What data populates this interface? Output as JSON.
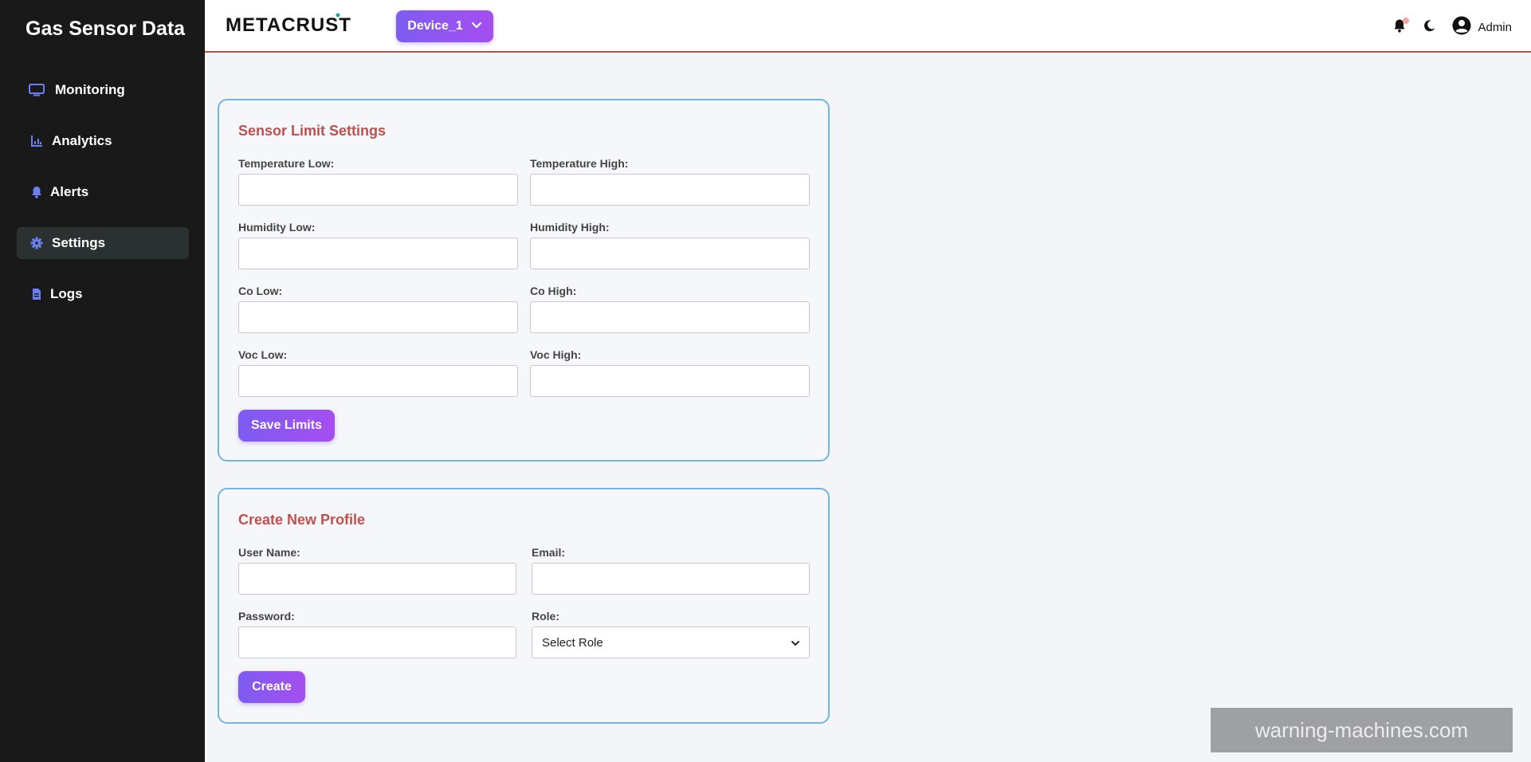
{
  "sidebar": {
    "brand": "Gas Sensor Data",
    "items": [
      {
        "label": "Monitoring",
        "icon": "monitor-icon",
        "active": false
      },
      {
        "label": "Analytics",
        "icon": "chart-icon",
        "active": false
      },
      {
        "label": "Alerts",
        "icon": "bell-icon",
        "active": false
      },
      {
        "label": "Settings",
        "icon": "gear-icon",
        "active": true
      },
      {
        "label": "Logs",
        "icon": "file-icon",
        "active": false
      }
    ]
  },
  "header": {
    "logo": "METACRUST",
    "device_selector": "Device_1",
    "user": "Admin",
    "icons": [
      "bell-icon",
      "moon-icon",
      "user-circle-icon"
    ]
  },
  "sensor_limits": {
    "title": "Sensor Limit Settings",
    "fields": [
      {
        "label": "Temperature Low:",
        "value": ""
      },
      {
        "label": "Temperature High:",
        "value": ""
      },
      {
        "label": "Humidity Low:",
        "value": ""
      },
      {
        "label": "Humidity High:",
        "value": ""
      },
      {
        "label": "Co Low:",
        "value": ""
      },
      {
        "label": "Co High:",
        "value": ""
      },
      {
        "label": "Voc Low:",
        "value": ""
      },
      {
        "label": "Voc High:",
        "value": ""
      }
    ],
    "save_label": "Save Limits"
  },
  "create_profile": {
    "title": "Create New Profile",
    "username_label": "User Name:",
    "email_label": "Email:",
    "password_label": "Password:",
    "role_label": "Role:",
    "role_value": "Select Role",
    "create_label": "Create"
  },
  "watermark": "warning-machines.com",
  "colors": {
    "sidebar_bg": "#191919",
    "accent_gradient_start": "#7d5cf0",
    "accent_gradient_end": "#a64ef0",
    "card_title": "#c0504d",
    "card_border": "#6fb6e2",
    "header_rule": "#b8514a"
  }
}
